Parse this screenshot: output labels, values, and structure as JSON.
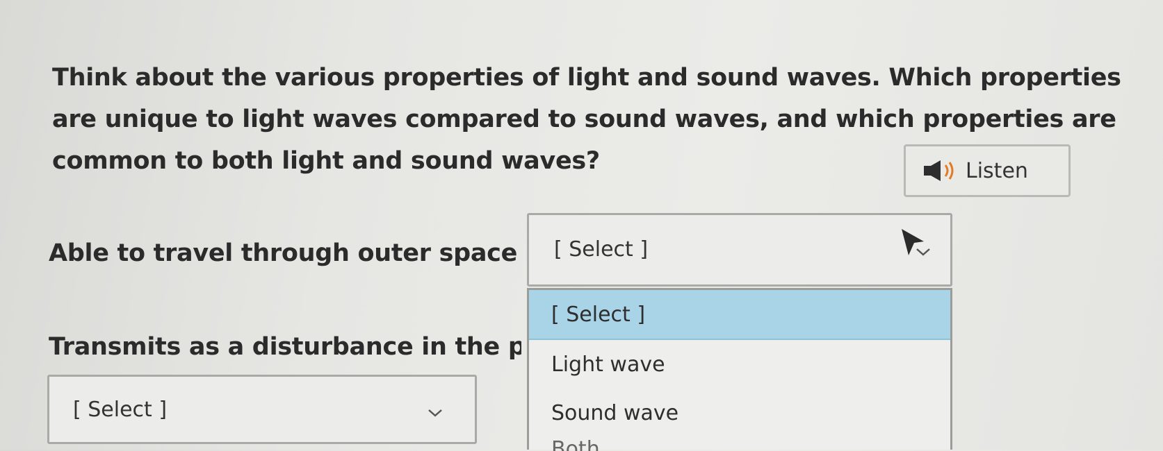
{
  "question": {
    "text": "Think about the various properties of light and sound waves. Which properties are unique to light waves compared to sound waves, and which properties are common to both light and sound waves?"
  },
  "listen_button": {
    "label": "Listen",
    "icon": "speaker-icon"
  },
  "items": [
    {
      "label": "Able to travel through outer space",
      "selected_value": "[ Select ]"
    },
    {
      "label": "Transmits as a disturbance in the pa",
      "selected_value": "[ Select ]"
    }
  ],
  "dropdown": {
    "options": [
      "[ Select ]",
      "Light wave",
      "Sound wave"
    ],
    "partial_option": "Both",
    "highlighted_index": 0
  },
  "colors": {
    "highlight": "#a9d3e6",
    "border": "#a9a9a6"
  }
}
